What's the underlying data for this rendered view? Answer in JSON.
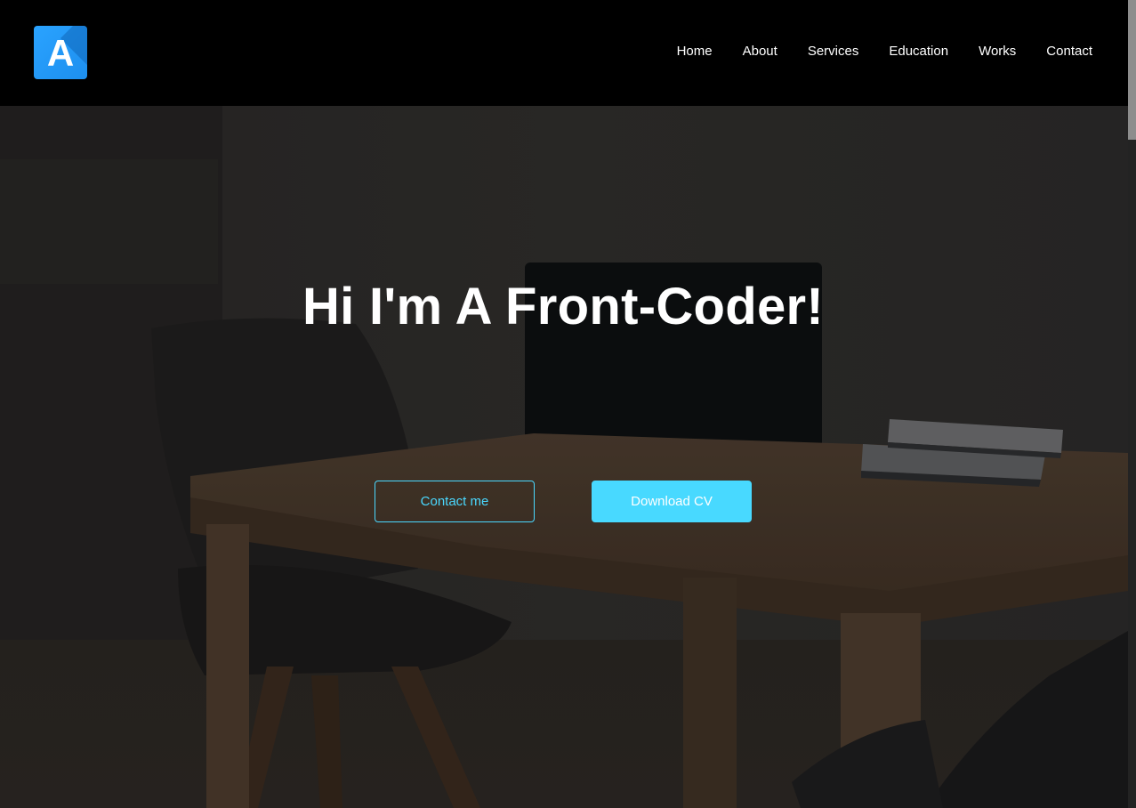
{
  "header": {
    "logo_letter": "A",
    "nav": [
      {
        "label": "Home"
      },
      {
        "label": "About"
      },
      {
        "label": "Services"
      },
      {
        "label": "Education"
      },
      {
        "label": "Works"
      },
      {
        "label": "Contact"
      }
    ]
  },
  "hero": {
    "title": "Hi I'm A Front-Coder!",
    "primary_button": "Contact me",
    "secondary_button": "Download CV",
    "background_image": "dark-desk-laptop-photo"
  },
  "colors": {
    "accent": "#48d9ff",
    "logo": "#1d8fef",
    "header_bg": "#000000"
  },
  "icons": {
    "logo": "letter-a-logo-icon"
  }
}
